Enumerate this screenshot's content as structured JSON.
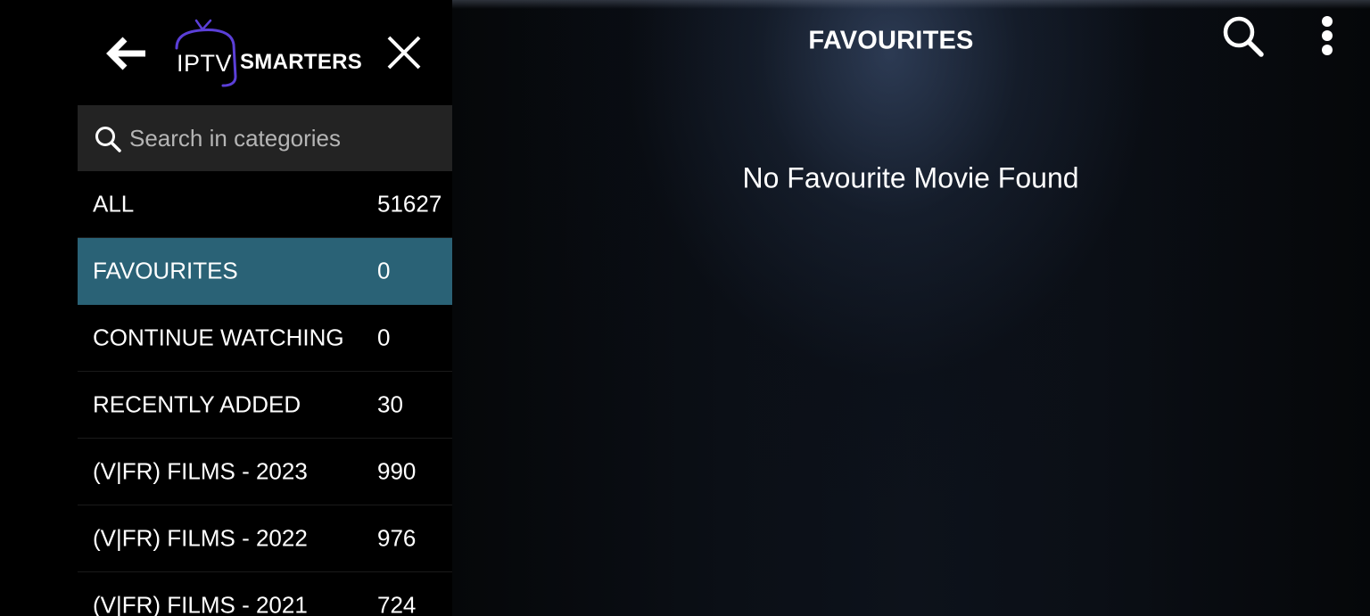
{
  "header": {
    "title": "FAVOURITES",
    "search_icon": "search-icon",
    "menu_icon": "more-vertical-icon"
  },
  "main": {
    "empty_message": "No Favourite Movie Found"
  },
  "sidebar": {
    "back_icon": "arrow-left-icon",
    "close_icon": "close-icon",
    "logo": {
      "text_left": "IPTV",
      "text_right": "SMARTERS",
      "accent_color": "#5b3fd8"
    },
    "search": {
      "placeholder": "Search in categories",
      "value": ""
    },
    "active_color": "#2a6276",
    "categories": [
      {
        "name": "ALL",
        "count": "51627",
        "active": false
      },
      {
        "name": "FAVOURITES",
        "count": "0",
        "active": true
      },
      {
        "name": "CONTINUE WATCHING",
        "count": "0",
        "active": false
      },
      {
        "name": "RECENTLY ADDED",
        "count": "30",
        "active": false
      },
      {
        "name": "(V|FR) FILMS - 2023",
        "count": "990",
        "active": false
      },
      {
        "name": "(V|FR) FILMS - 2022",
        "count": "976",
        "active": false
      },
      {
        "name": "(V|FR) FILMS - 2021",
        "count": "724",
        "active": false
      }
    ]
  }
}
